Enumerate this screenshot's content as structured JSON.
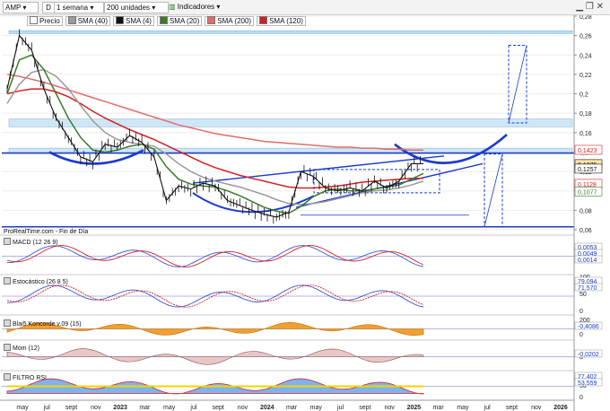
{
  "toolbar": {
    "symbol": "AMP",
    "period_key": "D",
    "period": "1 semana",
    "units": "200 unidades",
    "indicators": "Indicadores",
    "legend": [
      {
        "label": "Precio",
        "color": "#ffffff"
      },
      {
        "label": "SMA (40)",
        "color": "#9a9a9a"
      },
      {
        "label": "SMA (4)",
        "color": "#111111"
      },
      {
        "label": "SMA (20)",
        "color": "#3d7a2a"
      },
      {
        "label": "SMA (200)",
        "color": "#e36b6b"
      },
      {
        "label": "SMA (120)",
        "color": "#d42020"
      }
    ]
  },
  "source_note": "ProRealTime.com - Fin de Día",
  "panels": {
    "macd": {
      "label": "MACD (12 26 9)",
      "values": [
        "0,0053",
        "0,0049",
        "0,0014"
      ]
    },
    "stoch": {
      "label": "Estocástico (26 8 5)",
      "values": [
        "79,094",
        "71,570"
      ],
      "ticks": [
        "100",
        "50",
        "0"
      ]
    },
    "blai5": {
      "label": "Blai5 Koncorde v.09 (15)",
      "values": [
        "-0,4086"
      ],
      "ticks": [
        "200",
        "0"
      ]
    },
    "mom": {
      "label": "Mom (12)",
      "values": [
        "-0,0202"
      ],
      "ticks": [
        "0"
      ]
    },
    "rsi": {
      "label": "FILTRO RSI",
      "values": [
        "77,402",
        "53,559"
      ],
      "ticks": [
        "100",
        "50",
        "0"
      ]
    }
  },
  "price_axis": {
    "ticks": [
      "0,28",
      "0,26",
      "0,24",
      "0,22",
      "0,2",
      "0,18",
      "0,16",
      "0,14",
      "0,12",
      "0,1",
      "0,08",
      "0,06"
    ],
    "tags": [
      {
        "text": "0,1423",
        "color": "#d42020",
        "bg": "#ffffff",
        "value": 0.1423
      },
      {
        "text": "0,1276",
        "color": "#111111",
        "bg": "#ffe7a8",
        "value": 0.1276
      },
      {
        "text": "0,1257",
        "color": "#111111",
        "bg": "#ffffff",
        "value": 0.1257
      },
      {
        "text": "0,1128",
        "color": "#d42020",
        "bg": "#ffffff",
        "value": 0.1128
      },
      {
        "text": "0,1077",
        "color": "#3d7a2a",
        "bg": "#ffffff",
        "value": 0.1077
      }
    ]
  },
  "time_axis": [
    "may",
    "jul",
    "sept",
    "nov",
    "2023",
    "mar",
    "may",
    "jul",
    "sept",
    "nov",
    "2024",
    "mar",
    "may",
    "jul",
    "sept",
    "nov",
    "2025",
    "mar",
    "may",
    "jul",
    "sept",
    "nov",
    "2026"
  ],
  "chart_data": {
    "type": "line",
    "title": "AMP",
    "x": [
      "2022-04",
      "2022-05",
      "2022-06",
      "2022-07",
      "2022-08",
      "2022-09",
      "2022-10",
      "2022-11",
      "2022-12",
      "2023-01",
      "2023-02",
      "2023-03",
      "2023-04",
      "2023-05",
      "2023-06",
      "2023-07",
      "2023-08",
      "2023-09",
      "2023-10",
      "2023-11",
      "2023-12",
      "2024-01",
      "2024-02",
      "2024-03",
      "2024-04",
      "2024-05",
      "2024-06",
      "2024-07",
      "2024-08",
      "2024-09",
      "2024-10",
      "2024-11",
      "2024-12",
      "2025-01",
      "2025-02"
    ],
    "ylim": [
      0.06,
      0.28
    ],
    "series": [
      {
        "name": "Precio",
        "values": [
          0.205,
          0.26,
          0.245,
          0.205,
          0.175,
          0.155,
          0.135,
          0.13,
          0.148,
          0.145,
          0.157,
          0.15,
          0.135,
          0.09,
          0.105,
          0.102,
          0.108,
          0.105,
          0.09,
          0.085,
          0.08,
          0.076,
          0.073,
          0.078,
          0.12,
          0.115,
          0.103,
          0.1,
          0.103,
          0.1,
          0.11,
          0.103,
          0.11,
          0.128,
          0.128
        ]
      },
      {
        "name": "SMA (20)",
        "values": [
          0.2,
          0.235,
          0.24,
          0.225,
          0.2,
          0.175,
          0.155,
          0.142,
          0.14,
          0.142,
          0.146,
          0.148,
          0.143,
          0.125,
          0.112,
          0.107,
          0.105,
          0.104,
          0.1,
          0.095,
          0.089,
          0.083,
          0.079,
          0.077,
          0.084,
          0.094,
          0.1,
          0.102,
          0.1,
          0.1,
          0.102,
          0.104,
          0.106,
          0.112,
          0.118
        ]
      },
      {
        "name": "SMA (40)",
        "values": [
          0.19,
          0.21,
          0.222,
          0.225,
          0.218,
          0.205,
          0.188,
          0.172,
          0.16,
          0.153,
          0.15,
          0.148,
          0.146,
          0.138,
          0.128,
          0.12,
          0.114,
          0.11,
          0.107,
          0.104,
          0.1,
          0.096,
          0.091,
          0.087,
          0.086,
          0.087,
          0.089,
          0.092,
          0.095,
          0.098,
          0.1,
          0.101,
          0.103,
          0.106,
          0.11
        ]
      },
      {
        "name": "SMA (120)",
        "values": [
          0.2,
          0.203,
          0.205,
          0.205,
          0.202,
          0.197,
          0.19,
          0.182,
          0.175,
          0.169,
          0.163,
          0.158,
          0.153,
          0.147,
          0.141,
          0.135,
          0.129,
          0.124,
          0.12,
          0.116,
          0.113,
          0.11,
          0.107,
          0.104,
          0.103,
          0.103,
          0.104,
          0.105,
          0.107,
          0.109,
          0.11,
          0.111,
          0.112,
          0.113,
          0.113
        ]
      },
      {
        "name": "SMA (200)",
        "values": [
          0.22,
          0.218,
          0.215,
          0.212,
          0.208,
          0.204,
          0.2,
          0.196,
          0.192,
          0.188,
          0.184,
          0.18,
          0.176,
          0.172,
          0.168,
          0.165,
          0.162,
          0.159,
          0.157,
          0.155,
          0.153,
          0.151,
          0.15,
          0.149,
          0.148,
          0.147,
          0.146,
          0.145,
          0.145,
          0.144,
          0.144,
          0.143,
          0.143,
          0.142,
          0.142
        ]
      }
    ],
    "zones": [
      {
        "from": 0.262,
        "to": 0.265,
        "color": "#b8ddf5"
      },
      {
        "from": 0.166,
        "to": 0.174,
        "color": "#cfe6f7"
      },
      {
        "from": 0.139,
        "to": 0.144,
        "color": "#cfe6f7"
      }
    ],
    "hlines": [
      {
        "value": 0.139,
        "color": "#1a3bcc"
      },
      {
        "value": 0.063,
        "color": "#1a3bcc"
      }
    ]
  }
}
